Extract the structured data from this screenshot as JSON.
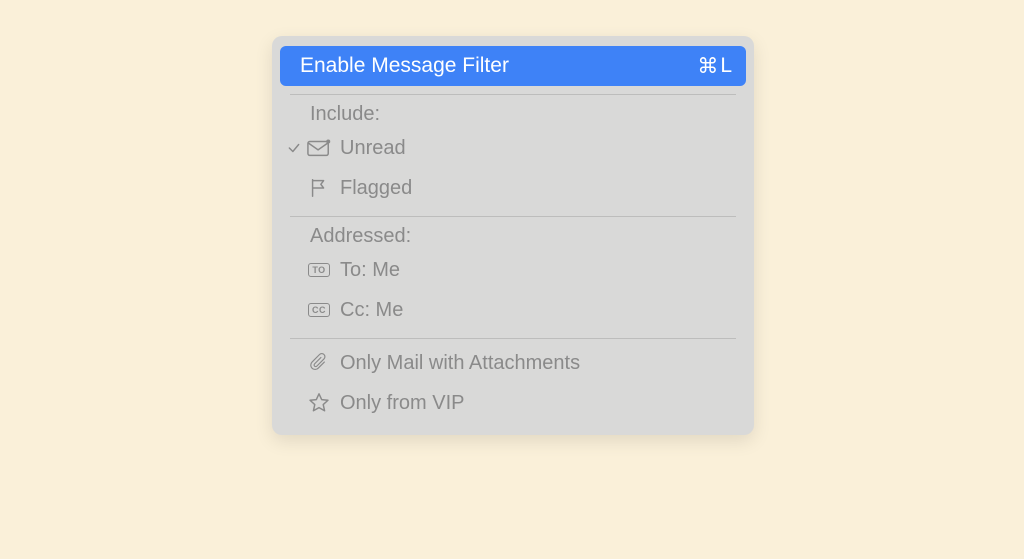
{
  "header": {
    "label": "Enable Message Filter",
    "shortcut_symbol": "⌘",
    "shortcut_key": "L"
  },
  "include": {
    "title": "Include:",
    "items": [
      {
        "label": "Unread",
        "checked": true
      },
      {
        "label": "Flagged",
        "checked": false
      }
    ]
  },
  "addressed": {
    "title": "Addressed:",
    "items": [
      {
        "label": "To: Me",
        "badge": "TO"
      },
      {
        "label": "Cc: Me",
        "badge": "CC"
      }
    ]
  },
  "other": {
    "items": [
      {
        "label": "Only Mail with Attachments"
      },
      {
        "label": "Only from VIP"
      }
    ]
  }
}
